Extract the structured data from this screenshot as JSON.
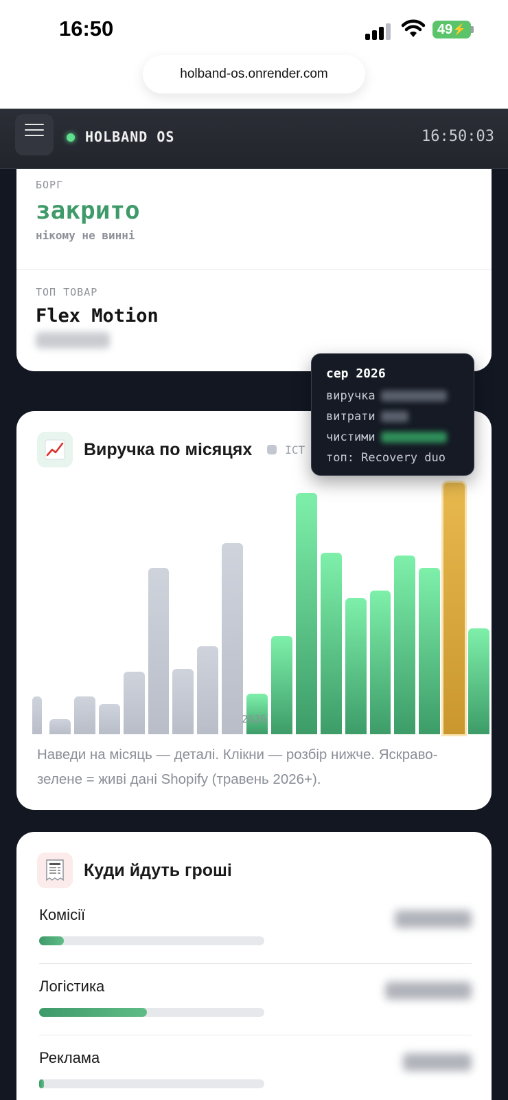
{
  "status_bar": {
    "time": "16:50",
    "battery": "49"
  },
  "browser": {
    "url": "holband-os.onrender.com"
  },
  "header": {
    "brand": "HOLBAND OS",
    "clock": "16:50:03"
  },
  "debt": {
    "label": "БОРГ",
    "value": "закрито",
    "sub": "нікому не винні"
  },
  "top_product": {
    "label": "ТОП ТОВАР",
    "value": "Flex Motion"
  },
  "revenue": {
    "title": "Виручка по місяцях",
    "legend_history": "ІСТ",
    "year_label": "2026",
    "note": "Наведи на місяць — деталі. Клікни — розбір нижче. Яскраво-зелене = живі дані Shopify (травень 2026+).",
    "colors": {
      "history": "#c3c7d1",
      "live": "#4fcf86",
      "selected": "#d9a83c"
    },
    "chart_data": {
      "type": "bar",
      "series": [
        {
          "values": [
            15,
            6,
            15,
            12,
            25,
            66,
            26,
            35,
            76,
            16,
            39,
            96,
            72,
            54,
            57,
            71,
            66,
            100,
            42
          ]
        }
      ],
      "kind": [
        "history",
        "history",
        "history",
        "history",
        "history",
        "history",
        "history",
        "history",
        "history",
        "live",
        "live",
        "live",
        "live",
        "live",
        "live",
        "live",
        "live",
        "selected",
        "live"
      ],
      "selected_index": 17
    }
  },
  "tooltip": {
    "title": "сер 2026",
    "revenue_label": "виручка",
    "expenses_label": "витрати",
    "net_label": "чистими",
    "top_label": "топ: Recovery duo"
  },
  "money": {
    "title": "Куди йдуть гроші",
    "items": [
      {
        "label": "Комісії",
        "fraction": 0.11
      },
      {
        "label": "Логістика",
        "fraction": 0.48
      },
      {
        "label": "Реклама",
        "fraction": 0.02
      }
    ]
  }
}
